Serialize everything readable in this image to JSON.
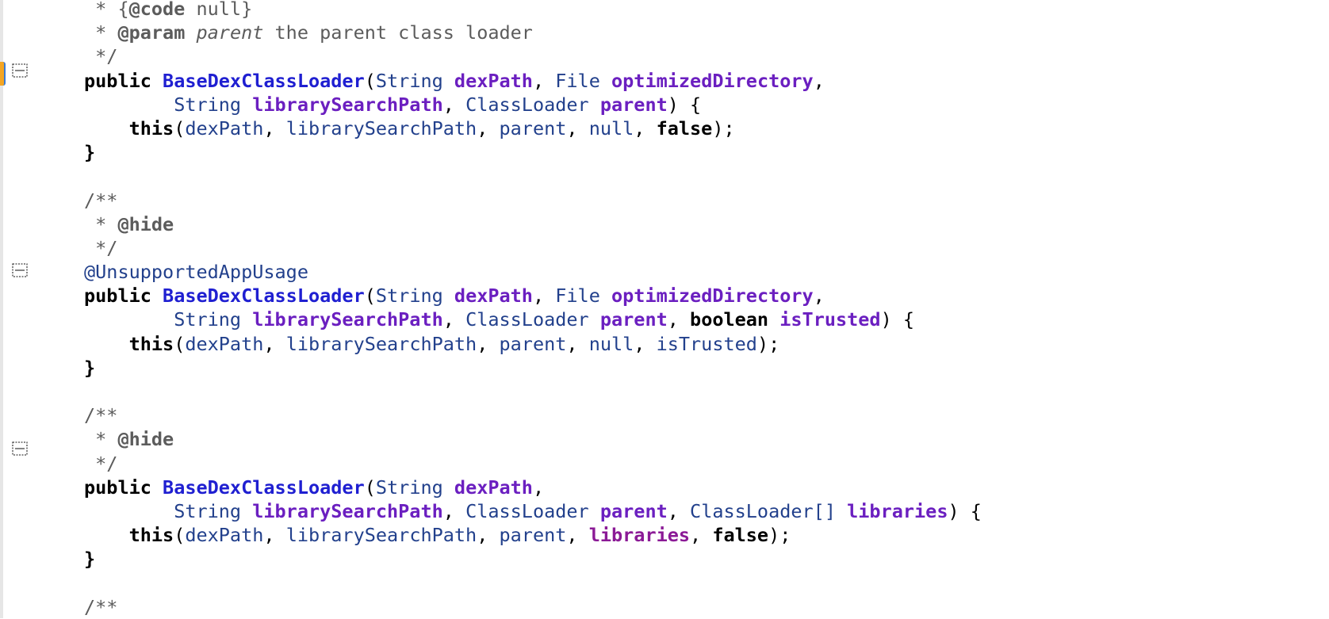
{
  "editor": {
    "lines": [
      [
        {
          "t": " * {",
          "c": "t-comment"
        },
        {
          "t": "@code",
          "c": "t-tag"
        },
        {
          "t": " null}",
          "c": "t-comment"
        }
      ],
      [
        {
          "t": " * ",
          "c": "t-comment"
        },
        {
          "t": "@param",
          "c": "t-tag"
        },
        {
          "t": " ",
          "c": "t-comment"
        },
        {
          "t": "parent",
          "c": "t-italic"
        },
        {
          "t": " the parent class loader",
          "c": "t-comment"
        }
      ],
      [
        {
          "t": " */",
          "c": "t-comment"
        }
      ],
      [
        {
          "t": "public",
          "c": "t-kw"
        },
        {
          "t": " ",
          "c": "t-punct"
        },
        {
          "t": "BaseDexClassLoader",
          "c": "t-method"
        },
        {
          "t": "(",
          "c": "t-punct"
        },
        {
          "t": "String",
          "c": "t-type"
        },
        {
          "t": " ",
          "c": "t-punct"
        },
        {
          "t": "dexPath",
          "c": "t-param"
        },
        {
          "t": ", ",
          "c": "t-punct"
        },
        {
          "t": "File",
          "c": "t-type"
        },
        {
          "t": " ",
          "c": "t-punct"
        },
        {
          "t": "optimizedDirectory",
          "c": "t-param"
        },
        {
          "t": ",",
          "c": "t-punct"
        }
      ],
      [
        {
          "t": "        ",
          "c": "t-punct"
        },
        {
          "t": "String",
          "c": "t-type"
        },
        {
          "t": " ",
          "c": "t-punct"
        },
        {
          "t": "librarySearchPath",
          "c": "t-param"
        },
        {
          "t": ", ",
          "c": "t-punct"
        },
        {
          "t": "ClassLoader",
          "c": "t-type"
        },
        {
          "t": " ",
          "c": "t-punct"
        },
        {
          "t": "parent",
          "c": "t-param"
        },
        {
          "t": ") {",
          "c": "t-punct"
        }
      ],
      [
        {
          "t": "    ",
          "c": "t-punct"
        },
        {
          "t": "this",
          "c": "t-kw"
        },
        {
          "t": "(",
          "c": "t-punct"
        },
        {
          "t": "dexPath",
          "c": "t-ident"
        },
        {
          "t": ", ",
          "c": "t-punct"
        },
        {
          "t": "librarySearchPath",
          "c": "t-ident"
        },
        {
          "t": ", ",
          "c": "t-punct"
        },
        {
          "t": "parent",
          "c": "t-ident"
        },
        {
          "t": ", ",
          "c": "t-punct"
        },
        {
          "t": "null",
          "c": "t-ident"
        },
        {
          "t": ", ",
          "c": "t-punct"
        },
        {
          "t": "false",
          "c": "t-kw"
        },
        {
          "t": ");",
          "c": "t-punct"
        }
      ],
      [
        {
          "t": "}",
          "c": "t-kw"
        }
      ],
      [],
      [
        {
          "t": "/**",
          "c": "t-comment"
        }
      ],
      [
        {
          "t": " * ",
          "c": "t-comment"
        },
        {
          "t": "@hide",
          "c": "t-tag"
        }
      ],
      [
        {
          "t": " */",
          "c": "t-comment"
        }
      ],
      [
        {
          "t": "@UnsupportedAppUsage",
          "c": "t-anno"
        }
      ],
      [
        {
          "t": "public",
          "c": "t-kw"
        },
        {
          "t": " ",
          "c": "t-punct"
        },
        {
          "t": "BaseDexClassLoader",
          "c": "t-method"
        },
        {
          "t": "(",
          "c": "t-punct"
        },
        {
          "t": "String",
          "c": "t-type"
        },
        {
          "t": " ",
          "c": "t-punct"
        },
        {
          "t": "dexPath",
          "c": "t-param"
        },
        {
          "t": ", ",
          "c": "t-punct"
        },
        {
          "t": "File",
          "c": "t-type"
        },
        {
          "t": " ",
          "c": "t-punct"
        },
        {
          "t": "optimizedDirectory",
          "c": "t-param"
        },
        {
          "t": ",",
          "c": "t-punct"
        }
      ],
      [
        {
          "t": "        ",
          "c": "t-punct"
        },
        {
          "t": "String",
          "c": "t-type"
        },
        {
          "t": " ",
          "c": "t-punct"
        },
        {
          "t": "librarySearchPath",
          "c": "t-param"
        },
        {
          "t": ", ",
          "c": "t-punct"
        },
        {
          "t": "ClassLoader",
          "c": "t-type"
        },
        {
          "t": " ",
          "c": "t-punct"
        },
        {
          "t": "parent",
          "c": "t-param"
        },
        {
          "t": ", ",
          "c": "t-punct"
        },
        {
          "t": "boolean",
          "c": "t-kw"
        },
        {
          "t": " ",
          "c": "t-punct"
        },
        {
          "t": "isTrusted",
          "c": "t-param"
        },
        {
          "t": ") {",
          "c": "t-punct"
        }
      ],
      [
        {
          "t": "    ",
          "c": "t-punct"
        },
        {
          "t": "this",
          "c": "t-kw"
        },
        {
          "t": "(",
          "c": "t-punct"
        },
        {
          "t": "dexPath",
          "c": "t-ident"
        },
        {
          "t": ", ",
          "c": "t-punct"
        },
        {
          "t": "librarySearchPath",
          "c": "t-ident"
        },
        {
          "t": ", ",
          "c": "t-punct"
        },
        {
          "t": "parent",
          "c": "t-ident"
        },
        {
          "t": ", ",
          "c": "t-punct"
        },
        {
          "t": "null",
          "c": "t-ident"
        },
        {
          "t": ", ",
          "c": "t-punct"
        },
        {
          "t": "isTrusted",
          "c": "t-ident"
        },
        {
          "t": ");",
          "c": "t-punct"
        }
      ],
      [
        {
          "t": "}",
          "c": "t-kw"
        }
      ],
      [],
      [
        {
          "t": "/**",
          "c": "t-comment"
        }
      ],
      [
        {
          "t": " * ",
          "c": "t-comment"
        },
        {
          "t": "@hide",
          "c": "t-tag"
        }
      ],
      [
        {
          "t": " */",
          "c": "t-comment"
        }
      ],
      [
        {
          "t": "public",
          "c": "t-kw"
        },
        {
          "t": " ",
          "c": "t-punct"
        },
        {
          "t": "BaseDexClassLoader",
          "c": "t-method"
        },
        {
          "t": "(",
          "c": "t-punct"
        },
        {
          "t": "String",
          "c": "t-type"
        },
        {
          "t": " ",
          "c": "t-punct"
        },
        {
          "t": "dexPath",
          "c": "t-param"
        },
        {
          "t": ",",
          "c": "t-punct"
        }
      ],
      [
        {
          "t": "        ",
          "c": "t-punct"
        },
        {
          "t": "String",
          "c": "t-type"
        },
        {
          "t": " ",
          "c": "t-punct"
        },
        {
          "t": "librarySearchPath",
          "c": "t-param"
        },
        {
          "t": ", ",
          "c": "t-punct"
        },
        {
          "t": "ClassLoader",
          "c": "t-type"
        },
        {
          "t": " ",
          "c": "t-punct"
        },
        {
          "t": "parent",
          "c": "t-param"
        },
        {
          "t": ", ",
          "c": "t-punct"
        },
        {
          "t": "ClassLoader[]",
          "c": "t-type"
        },
        {
          "t": " ",
          "c": "t-punct"
        },
        {
          "t": "libraries",
          "c": "t-param"
        },
        {
          "t": ") {",
          "c": "t-punct"
        }
      ],
      [
        {
          "t": "    ",
          "c": "t-punct"
        },
        {
          "t": "this",
          "c": "t-kw"
        },
        {
          "t": "(",
          "c": "t-punct"
        },
        {
          "t": "dexPath",
          "c": "t-ident"
        },
        {
          "t": ", ",
          "c": "t-punct"
        },
        {
          "t": "librarySearchPath",
          "c": "t-ident"
        },
        {
          "t": ", ",
          "c": "t-punct"
        },
        {
          "t": "parent",
          "c": "t-ident"
        },
        {
          "t": ", ",
          "c": "t-punct"
        },
        {
          "t": "libraries",
          "c": "t-field"
        },
        {
          "t": ", ",
          "c": "t-punct"
        },
        {
          "t": "false",
          "c": "t-kw"
        },
        {
          "t": ");",
          "c": "t-punct"
        }
      ],
      [
        {
          "t": "}",
          "c": "t-kw"
        }
      ],
      [],
      [
        {
          "t": "/**",
          "c": "t-comment"
        }
      ]
    ],
    "fold_icon": "fold-collapse-icon",
    "colors": {
      "method": "#1f1fd1",
      "param": "#6b1fc0",
      "type": "#22408c",
      "field": "#8b1a96",
      "comment": "#5c5c5c"
    }
  }
}
